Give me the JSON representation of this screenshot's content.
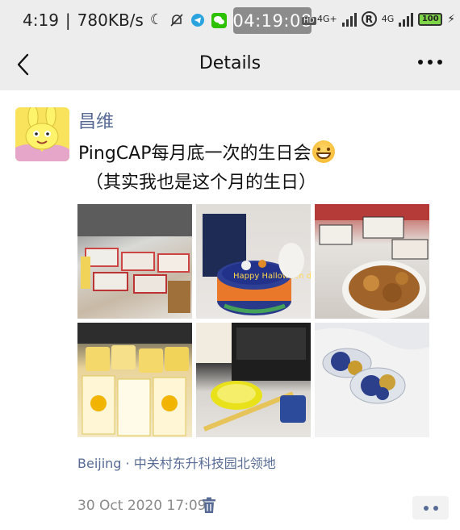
{
  "status_bar": {
    "time": "4:19",
    "speed": "780KB/s",
    "clock_pill": "04:19:08",
    "hd_badge": "HD",
    "network1": "4G+",
    "network2": "4G",
    "battery": "100",
    "icons": [
      "moon-icon",
      "bell-off-icon",
      "telegram-icon",
      "wechat-icon",
      "registered-icon",
      "charging-icon"
    ]
  },
  "nav": {
    "title": "Details",
    "back_icon": "chevron-left-icon",
    "more_icon": "more-dots-icon"
  },
  "post": {
    "author": "昌维",
    "text_line1": "PingCAP每月底一次的生日会",
    "emoji": "grinning-emoji",
    "text_line2": "（其实我也是这个月的生日）",
    "photos": [
      {
        "subject": "food boxes on table"
      },
      {
        "subject": "Halloween cake"
      },
      {
        "subject": "fried food in bowl"
      },
      {
        "subject": "milk tea cups"
      },
      {
        "subject": "laptop and drinks"
      },
      {
        "subject": "wrapped candy"
      }
    ],
    "cake_text": "Happy Halloween day",
    "location": "Beijing · 中关村东升科技园北领地",
    "timestamp": "30 Oct 2020 17:09"
  },
  "colors": {
    "link": "#576b95",
    "bar_bg": "#ededed",
    "meta": "#8a8a8a"
  }
}
